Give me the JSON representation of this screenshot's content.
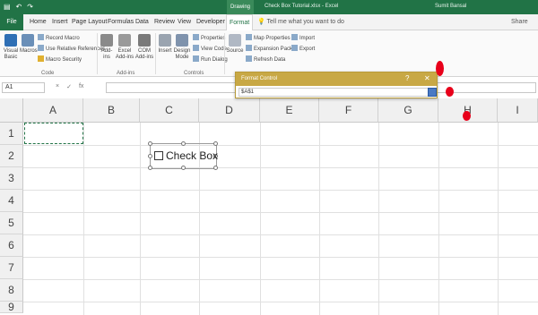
{
  "titlebar": {
    "contextual_tab_label": "Drawing Tools",
    "document_title": "Check Box Tutorial.xlsx - Excel",
    "user": "Sumit Bansal"
  },
  "tabs": [
    "File",
    "Home",
    "Insert",
    "Page Layout",
    "Formulas",
    "Data",
    "Review",
    "View",
    "Developer",
    "Format"
  ],
  "tell_me": "Tell me what you want to do",
  "share": "Share",
  "ribbon": {
    "code": {
      "visual_basic": "Visual Basic",
      "macros": "Macros",
      "record_macro": "Record Macro",
      "use_relative_references": "Use Relative References",
      "macro_security": "Macro Security",
      "label": "Code"
    },
    "addins": {
      "addins": "Add-ins",
      "excel_addins": "Excel Add-ins",
      "com_addins": "COM Add-ins",
      "label": "Add-ins"
    },
    "controls": {
      "insert": "Insert",
      "design_mode": "Design Mode",
      "properties": "Properties",
      "view_code": "View Code",
      "run_dialog": "Run Dialog",
      "label": "Controls"
    },
    "xml": {
      "source": "Source",
      "map_properties": "Map Properties",
      "expansion_packs": "Expansion Packs",
      "refresh_data": "Refresh Data",
      "import": "Import",
      "export": "Export"
    }
  },
  "formula_bar": {
    "name_box": "A1",
    "tools": [
      "×",
      "✓",
      "fx"
    ]
  },
  "grid": {
    "columns": [
      "A",
      "B",
      "C",
      "D",
      "E",
      "F",
      "G",
      "H",
      "I"
    ],
    "rows": [
      "1",
      "2",
      "3",
      "4",
      "5",
      "6",
      "7",
      "8",
      "9"
    ]
  },
  "checkbox_control": {
    "label": "Check Box"
  },
  "dialog": {
    "title": "Format Control",
    "help": "?",
    "close": "✕",
    "cell_link": "$A$1"
  }
}
